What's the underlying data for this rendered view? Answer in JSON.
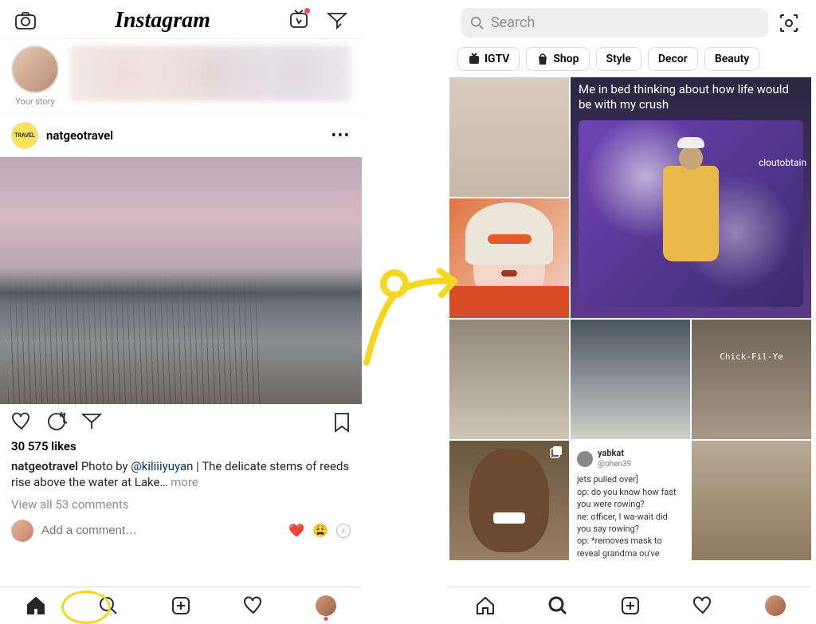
{
  "left": {
    "header": {
      "logo_text": "Instagram"
    },
    "stories": {
      "your_story_label": "Your story"
    },
    "post": {
      "username": "natgeotravel",
      "avatar_text": "TRAVEL",
      "likes": "30 575 likes",
      "caption_username": "natgeotravel",
      "caption_text_1": " Photo by ",
      "caption_mention": "@kiliiiyuyan",
      "caption_text_2": " | The delicate stems of reeds rise above the water at Lake… ",
      "caption_more": "more",
      "view_comments": "View all 53 comments",
      "add_comment_placeholder": "Add a comment…",
      "emoji_heart": "❤️",
      "emoji_face": "😩"
    }
  },
  "right": {
    "search_placeholder": "Search",
    "chips": [
      {
        "label": "IGTV",
        "icon": "tv"
      },
      {
        "label": "Shop",
        "icon": "bag"
      },
      {
        "label": "Style",
        "icon": ""
      },
      {
        "label": "Decor",
        "icon": ""
      },
      {
        "label": "Beauty",
        "icon": ""
      }
    ],
    "meme_text": "Me in bed thinking about how life would be with my crush",
    "meme_watermark": "cloutobtain",
    "food_label": "Chick-Fil-Ye",
    "tweet": {
      "user": "yabkat",
      "handle": "@ohen39",
      "lines": [
        "jets pulled over]",
        "op: do you know how fast you were rowing?",
        "ne: officer, I wa-wait did you say rowing?",
        "op: *removes mask to reveal grandma ou've gotten so big"
      ]
    }
  },
  "colors": {
    "highlight": "#f5d720",
    "link": "#00376b",
    "red": "#ed4956"
  }
}
